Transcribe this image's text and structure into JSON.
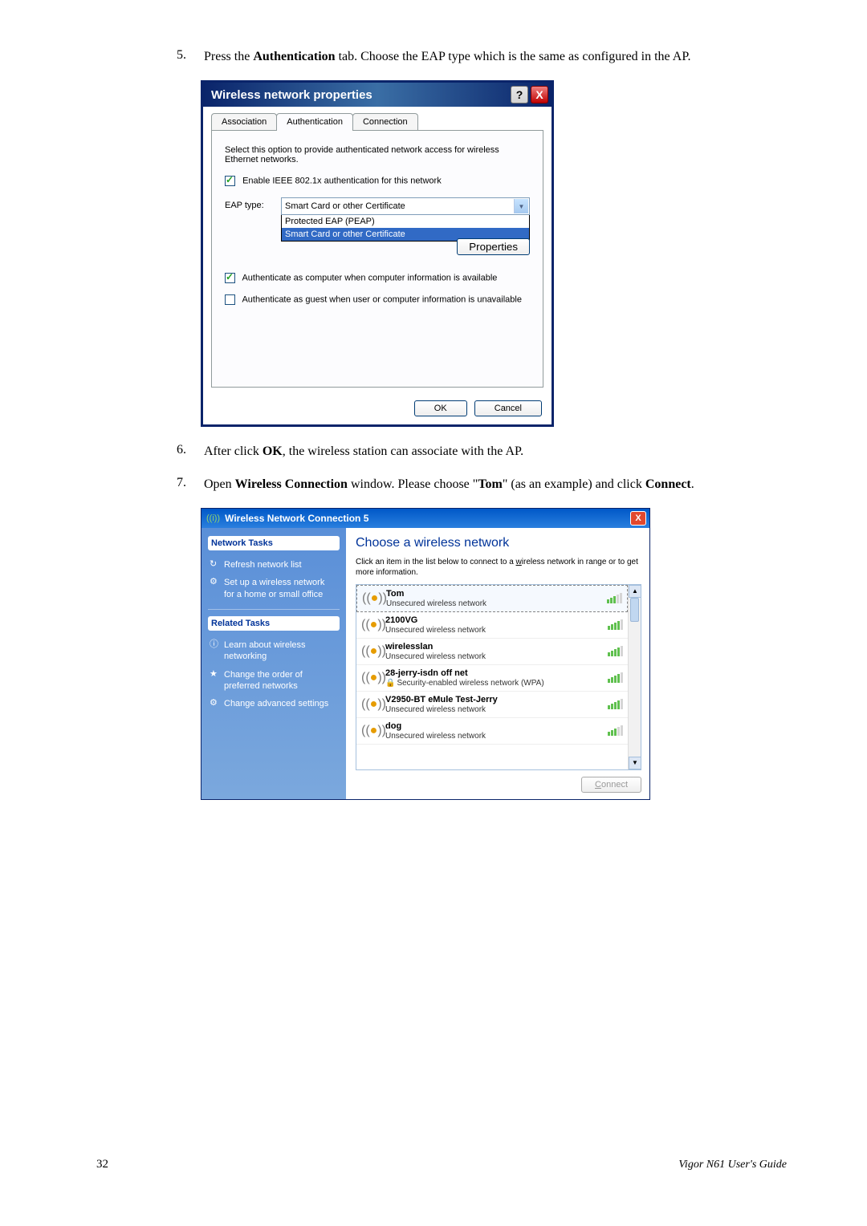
{
  "steps": {
    "s5": {
      "num": "5.",
      "pre": "Press the ",
      "b1": "Authentication",
      "post": " tab. Choose the EAP type which is the same as configured in the AP."
    },
    "s6": {
      "num": "6.",
      "pre": "After click ",
      "b1": "OK",
      "post": ", the wireless station can associate with the AP."
    },
    "s7": {
      "num": "7.",
      "pre": "Open ",
      "b1": "Wireless Connection",
      "mid1": " window. Please choose \"",
      "b2": "Tom",
      "mid2": "\" (as an example) and click ",
      "b3": "Connect",
      "post": "."
    }
  },
  "dialog1": {
    "title": "Wireless network properties",
    "help": "?",
    "close": "X",
    "tabs": {
      "assoc": "Association",
      "auth": "Authentication",
      "conn": "Connection"
    },
    "intro": "Select this option to provide authenticated network access for wireless Ethernet networks.",
    "cb_enable": "Enable IEEE 802.1x authentication for this network",
    "eap_label": "EAP type:",
    "eap_selected": "Smart Card or other Certificate",
    "eap_options": {
      "peap": "Protected EAP (PEAP)",
      "smart": "Smart Card or other Certificate"
    },
    "properties": "Properties",
    "cb_comp": "Authenticate as computer when computer information is available",
    "cb_guest": "Authenticate as guest when user or computer information is unavailable",
    "ok": "OK",
    "cancel": "Cancel"
  },
  "dialog2": {
    "title": "Wireless Network Connection 5",
    "close": "X",
    "side_head1": "Network Tasks",
    "side_head2": "Related Tasks",
    "links": {
      "refresh": "Refresh network list",
      "setup": "Set up a wireless network for a home or small office",
      "learn": "Learn about wireless networking",
      "order": "Change the order of preferred networks",
      "adv": "Change advanced settings"
    },
    "main_head": "Choose a wireless network",
    "main_sub_pre": "Click an item in the list below to connect to a ",
    "main_sub_u": "w",
    "main_sub_post": "ireless network in range or to get more information.",
    "networks": [
      {
        "name": "Tom",
        "status": "Unsecured wireless network",
        "secured": false,
        "signal": 3,
        "selected": true
      },
      {
        "name": "2100VG",
        "status": "Unsecured wireless network",
        "secured": false,
        "signal": 4,
        "selected": false
      },
      {
        "name": "wirelesslan",
        "status": "Unsecured wireless network",
        "secured": false,
        "signal": 4,
        "selected": false
      },
      {
        "name": "28-jerry-isdn off net",
        "status": "Security-enabled wireless network (WPA)",
        "secured": true,
        "signal": 4,
        "selected": false
      },
      {
        "name": "V2950-BT eMule Test-Jerry",
        "status": "Unsecured wireless network",
        "secured": false,
        "signal": 4,
        "selected": false
      },
      {
        "name": "dog",
        "status": "Unsecured wireless network",
        "secured": false,
        "signal": 3,
        "selected": false
      }
    ],
    "connect_u": "C",
    "connect_r": "onnect"
  },
  "page_number": "32",
  "footer": "Vigor N61 User's Guide",
  "chart_data": null
}
